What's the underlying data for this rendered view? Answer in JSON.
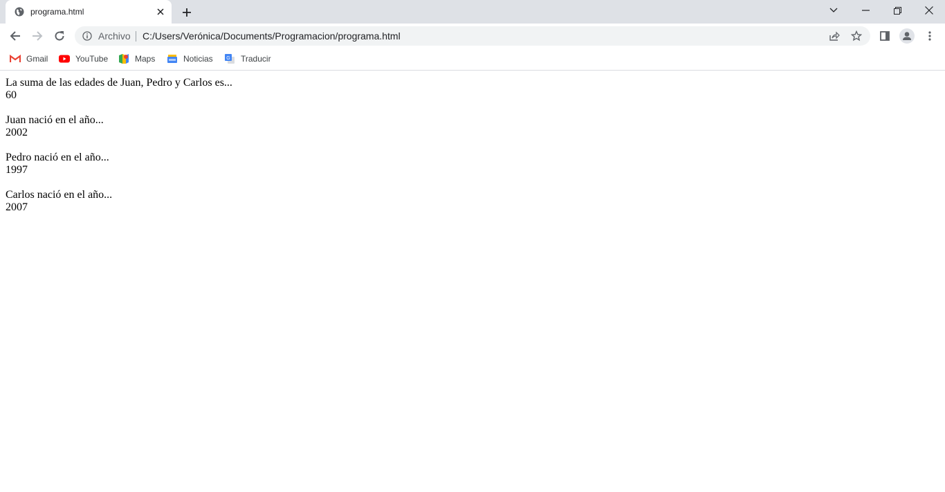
{
  "browser": {
    "tab": {
      "title": "programa.html"
    },
    "omnibox": {
      "security_chip": "Archivo",
      "url": "C:/Users/Verónica/Documents/Programacion/programa.html"
    },
    "bookmarks": [
      {
        "label": "Gmail",
        "icon": "gmail-icon"
      },
      {
        "label": "YouTube",
        "icon": "youtube-icon"
      },
      {
        "label": "Maps",
        "icon": "maps-icon"
      },
      {
        "label": "Noticias",
        "icon": "news-icon"
      },
      {
        "label": "Traducir",
        "icon": "translate-icon"
      }
    ]
  },
  "page": {
    "blocks": [
      {
        "label": "La suma de las edades de Juan, Pedro y Carlos es...",
        "value": "60"
      },
      {
        "label": "Juan nació en el año...",
        "value": "2002"
      },
      {
        "label": "Pedro nació en el año...",
        "value": "1997"
      },
      {
        "label": "Carlos nació en el año...",
        "value": "2007"
      }
    ]
  }
}
